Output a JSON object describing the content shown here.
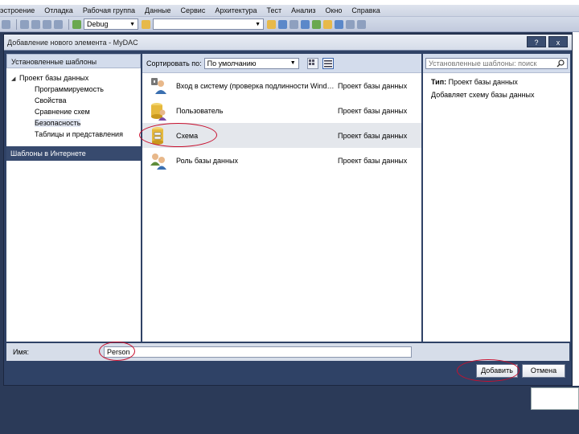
{
  "menu": [
    "эстроение",
    "Отладка",
    "Рабочая группа",
    "Данные",
    "Сервис",
    "Архитектура",
    "Тест",
    "Анализ",
    "Окно",
    "Справка"
  ],
  "toolbar": {
    "config_combo": "Debug",
    "search_value": ""
  },
  "dialog": {
    "title": "Добавление нового элемента - MyDAC",
    "help_button": "?",
    "close_button": "x",
    "left": {
      "installed_header": "Установленные шаблоны",
      "tree_root": "Проект базы данных",
      "tree_children": [
        "Программируемость",
        "Свойства",
        "Сравнение схем",
        "Безопасность",
        "Таблицы и представления"
      ],
      "online_templates": "Шаблоны в Интернете"
    },
    "middle": {
      "sort_label": "Сортировать по:",
      "sort_value": "По умолчанию",
      "templates": [
        {
          "name": "Вход в систему (проверка подлинности Windo...",
          "type": "Проект базы данных",
          "icon": "login-user-icon"
        },
        {
          "name": "Пользователь",
          "type": "Проект базы данных",
          "icon": "database-user-icon"
        },
        {
          "name": "Схема",
          "type": "Проект базы данных",
          "icon": "schema-icon"
        },
        {
          "name": "Роль базы данных",
          "type": "Проект базы данных",
          "icon": "database-role-icon"
        }
      ]
    },
    "right": {
      "search_placeholder": "Установленные шаблоны: поиск",
      "type_label": "Тип:",
      "type_value": "Проект базы данных",
      "description": "Добавляет схему базы данных"
    },
    "name_label": "Имя:",
    "name_value": "Person",
    "add_button": "Добавить",
    "cancel_button": "Отмена"
  },
  "colors": {
    "dialog_bg": "#2f4266",
    "highlight_ellipse": "#c8102e",
    "selected_row": "#e4e7ec"
  }
}
